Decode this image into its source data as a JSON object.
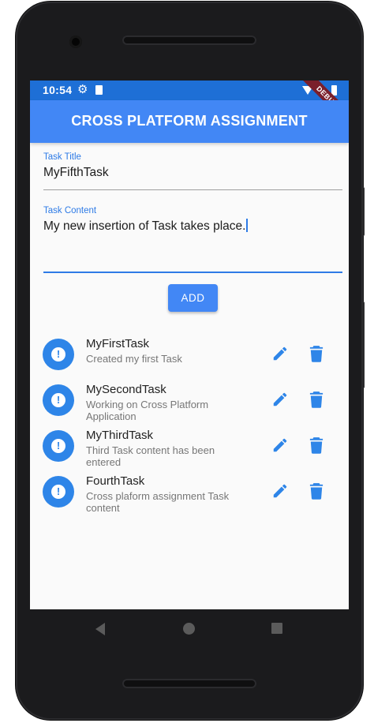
{
  "statusbar": {
    "time": "10:54",
    "debug_label": "DEBUG"
  },
  "appbar": {
    "title": "CROSS PLATFORM ASSIGNMENT"
  },
  "form": {
    "title_label": "Task Title",
    "title_value": "MyFifthTask",
    "content_label": "Task Content",
    "content_value": "My new insertion of Task takes place.",
    "add_label": "ADD"
  },
  "tasks": [
    {
      "title": "MyFirstTask",
      "content": "Created my first Task"
    },
    {
      "title": "MySecondTask",
      "content": "Working on Cross Platform Application"
    },
    {
      "title": "MyThirdTask",
      "content": "Third Task content has been entered"
    },
    {
      "title": "FourthTask",
      "content": "Cross plaform assignment Task content"
    }
  ],
  "colors": {
    "appbar": "#4287f5",
    "statusbar": "#1e6fd6",
    "accent": "#2e85e8",
    "focus_line": "#2e7be6"
  },
  "icons": {
    "task_avatar": "info-icon",
    "edit": "pencil-icon",
    "delete": "trash-icon"
  }
}
